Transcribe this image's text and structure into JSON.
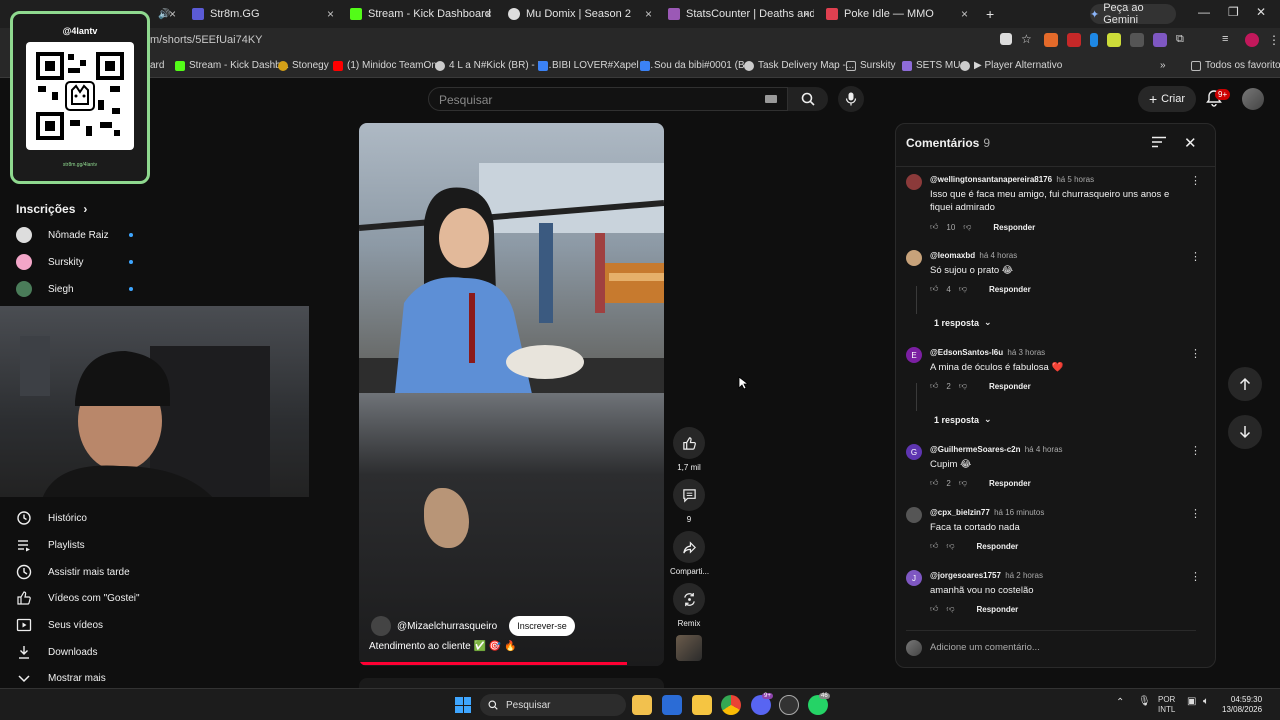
{
  "browser": {
    "tabs": [
      {
        "label": "Str8m.GG",
        "color": "#5b5bd6"
      },
      {
        "label": "Stream - Kick Dashboard",
        "color": "#53fc18"
      },
      {
        "label": "Mu Domix | Season 2",
        "color": "#dddddd"
      },
      {
        "label": "StatsCounter | Deaths and trop",
        "color": "#9b59b6"
      },
      {
        "label": "Poke Idle — MMO",
        "color": "#e04050"
      }
    ],
    "new_tab": "+",
    "gemini_label": "Peça ao Gemini",
    "url": "m/shorts/5EEfUai74KY",
    "bookmarks": [
      {
        "label": "ard",
        "color": "#282828"
      },
      {
        "label": "Stream - Kick Dashb...",
        "color": "#53fc18"
      },
      {
        "label": "Stonegy",
        "color": "#d4a017"
      },
      {
        "label": "(1) Minidoc TeamOn...",
        "color": "#ff0000"
      },
      {
        "label": "4 L a N#Kick (BR) - L...",
        "color": "#cccccc"
      },
      {
        "label": "BIBI LOVER#Xapel (...",
        "color": "#3b82f6"
      },
      {
        "label": "Sou da bibi#0001 (B...",
        "color": "#3b82f6"
      },
      {
        "label": "Task Delivery Map -...",
        "color": "#cccccc"
      },
      {
        "label": "Surskity",
        "color": "#888888"
      },
      {
        "label": "SETS MU",
        "color": "#8e6cd8"
      },
      {
        "label": "▶ Player Alternativo",
        "color": "#cccccc"
      }
    ],
    "bookmarks_more": "»",
    "all_favorites": "Todos os favoritos"
  },
  "yt_header": {
    "search_placeholder": "Pesquisar",
    "create_label": "Criar",
    "notif_badge": "9+"
  },
  "qr": {
    "title": "@4lantv",
    "footer": "str8m.gg/4lantv"
  },
  "sidebar": {
    "subscriptions_title": "Inscrições",
    "subscriptions": [
      {
        "name": "Nômade Raiz",
        "color": "#dddddd"
      },
      {
        "name": "Surskity",
        "color": "#f3a6c8"
      },
      {
        "name": "Siegh",
        "color": "#4a7c59"
      }
    ],
    "items": [
      {
        "label": "Histórico",
        "icon": "history-icon"
      },
      {
        "label": "Playlists",
        "icon": "playlist-icon"
      },
      {
        "label": "Assistir mais tarde",
        "icon": "clock-icon"
      },
      {
        "label": "Vídeos com \"Gostei\"",
        "icon": "thumb-up-icon"
      },
      {
        "label": "Seus vídeos",
        "icon": "video-icon"
      },
      {
        "label": "Downloads",
        "icon": "download-icon"
      },
      {
        "label": "Mostrar mais",
        "icon": "chevron-down-icon"
      }
    ]
  },
  "short": {
    "channel": "@Mizaelchurrasqueiro",
    "subscribe_label": "Inscrever-se",
    "caption": "Atendimento ao cliente ✅ 🎯 🔥",
    "progress": 0.88,
    "actions": {
      "like_count": "1,7 mil",
      "comment_count": "9",
      "share_label": "Comparti...",
      "remix_label": "Remix"
    }
  },
  "comments": {
    "title": "Comentários",
    "count": "9",
    "add_placeholder": "Adicione um comentário...",
    "reply_label": "Responder",
    "items": [
      {
        "author": "@wellingtonsantanapereira8176",
        "time": "há 5 horas",
        "text": "Isso que é faca meu amigo, fui churrasqueiro uns anos e fiquei admirado",
        "likes": "10",
        "avatar_color": "#8b3a3a",
        "initial": ""
      },
      {
        "author": "@leomaxbd",
        "time": "há 4 horas",
        "text": "Só sujou o prato 😂",
        "likes": "4",
        "avatar_color": "#c7a27a",
        "initial": "",
        "replies": "1 resposta"
      },
      {
        "author": "@EdsonSantos-l6u",
        "time": "há 3 horas",
        "text": "A mina de óculos é fabulosa ❤️",
        "likes": "2",
        "avatar_color": "#7b1fa2",
        "initial": "E",
        "replies": "1 resposta"
      },
      {
        "author": "@GuilhermeSoares-c2n",
        "time": "há 4 horas",
        "text": "Cupim 😂",
        "likes": "2",
        "avatar_color": "#5e35b1",
        "initial": "G"
      },
      {
        "author": "@cpx_bielzin77",
        "time": "há 16 minutos",
        "text": "Faca ta cortado nada",
        "likes": "",
        "avatar_color": "#555555",
        "initial": ""
      },
      {
        "author": "@jorgesoares1757",
        "time": "há 2 horas",
        "text": "amanhã vou no costelão",
        "likes": "",
        "avatar_color": "#7e57c2",
        "initial": "J"
      }
    ]
  },
  "taskbar": {
    "search_label": "Pesquisar",
    "badge_discord": "9+",
    "badge_whatsapp": "46",
    "lang_top": "POR",
    "lang_bottom": "INTL",
    "time": "04:59:30",
    "date": "13/08/2026"
  },
  "colors": {
    "accent_red": "#ff0033",
    "link_blue": "#3ea6ff",
    "qr_border": "#8fd98f"
  }
}
